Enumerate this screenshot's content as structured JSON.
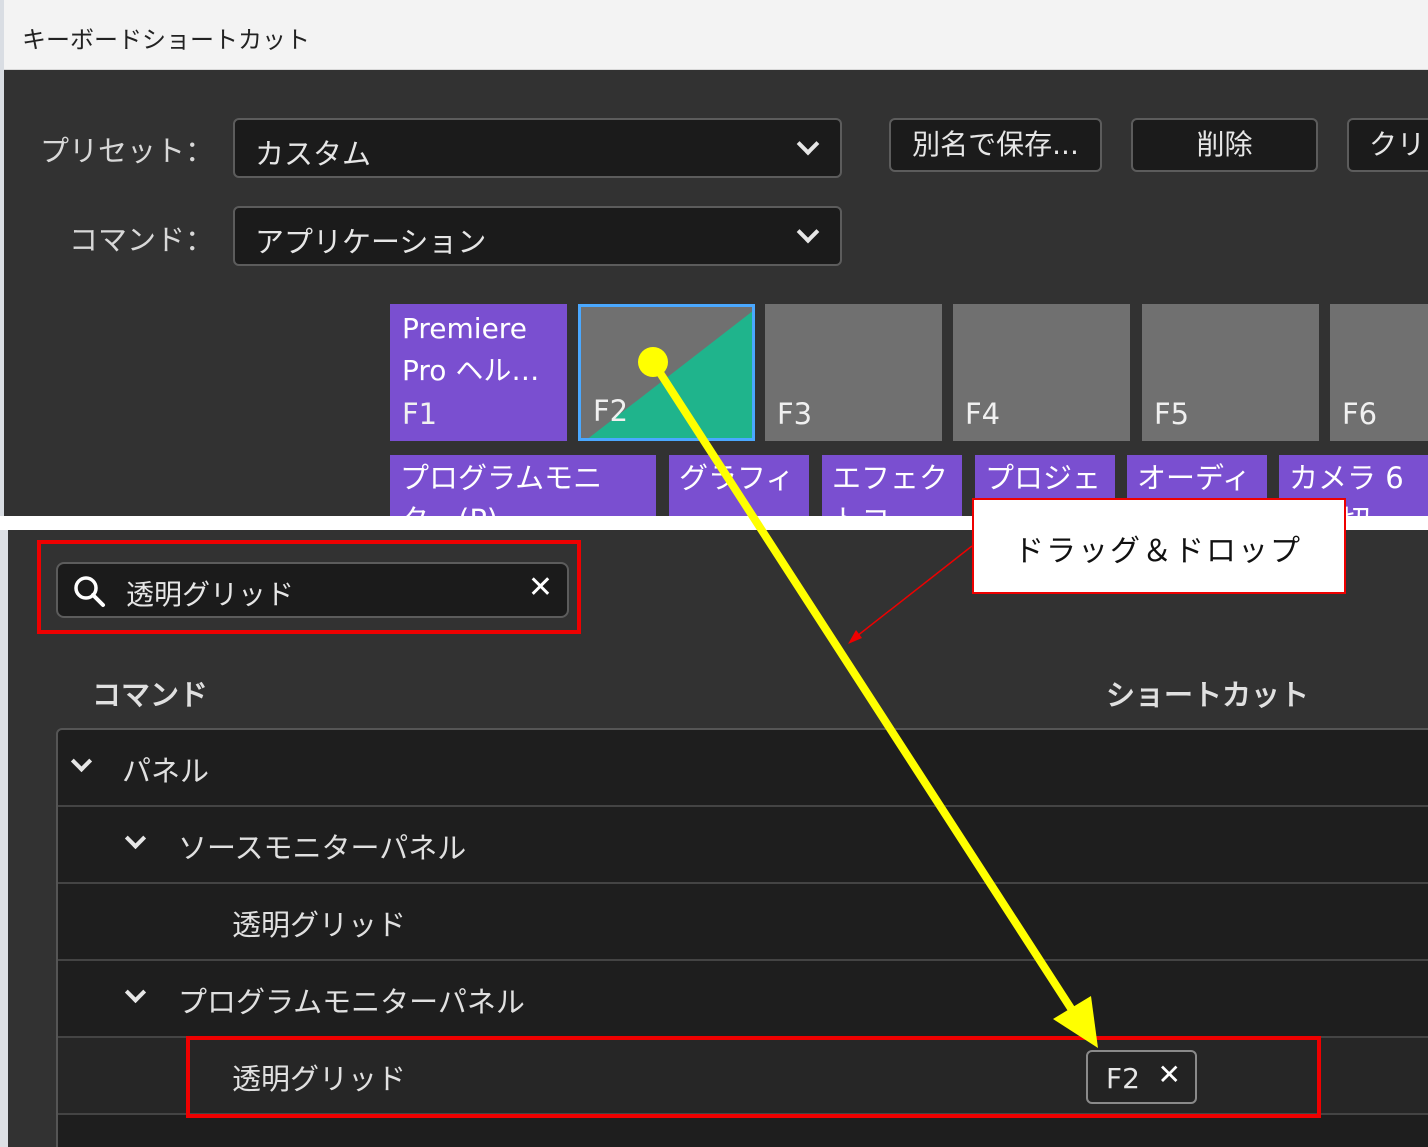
{
  "window": {
    "title": "キーボードショートカット"
  },
  "preset": {
    "label": "プリセット：",
    "value": "カスタム"
  },
  "command": {
    "label": "コマンド：",
    "value": "アプリケーション"
  },
  "buttons": {
    "save_as": "別名で保存...",
    "delete": "削除",
    "clear": "クリ"
  },
  "keyboard": {
    "f1": {
      "key": "F1",
      "command_line1": "Premiere",
      "command_line2": "Pro ヘル…"
    },
    "f2": {
      "key": "F2"
    },
    "f3": {
      "key": "F3"
    },
    "f4": {
      "key": "F4"
    },
    "f5": {
      "key": "F5"
    },
    "f6": {
      "key": "F6"
    },
    "row2": [
      {
        "line1": "プログラムモニ",
        "line2": "ター(P)"
      },
      {
        "line1": "グラフィ",
        "line2": "…"
      },
      {
        "line1": "エフェク",
        "line2": "トコ…"
      },
      {
        "line1": "プロジェ",
        "line2": ""
      },
      {
        "line1": "オーディ",
        "line2": ""
      },
      {
        "line1": "カメラ 6",
        "line2": "切"
      }
    ]
  },
  "search": {
    "value": "透明グリッド"
  },
  "columns": {
    "command": "コマンド",
    "shortcut": "ショートカット"
  },
  "tree": {
    "panel": "パネル",
    "source_monitor": "ソースモニターパネル",
    "source_item": "透明グリッド",
    "program_monitor": "プログラムモニターパネル",
    "program_item": "透明グリッド",
    "program_item_shortcut": "F2"
  },
  "annotation": {
    "callout": "ドラッグ＆ドロップ"
  },
  "colors": {
    "assigned_key": "#7a4fd0",
    "application_shortcut": "#1fb48c",
    "selected_border": "#4aa8ff",
    "highlight_red": "#ee0000",
    "arrow_yellow": "#ffff00"
  }
}
